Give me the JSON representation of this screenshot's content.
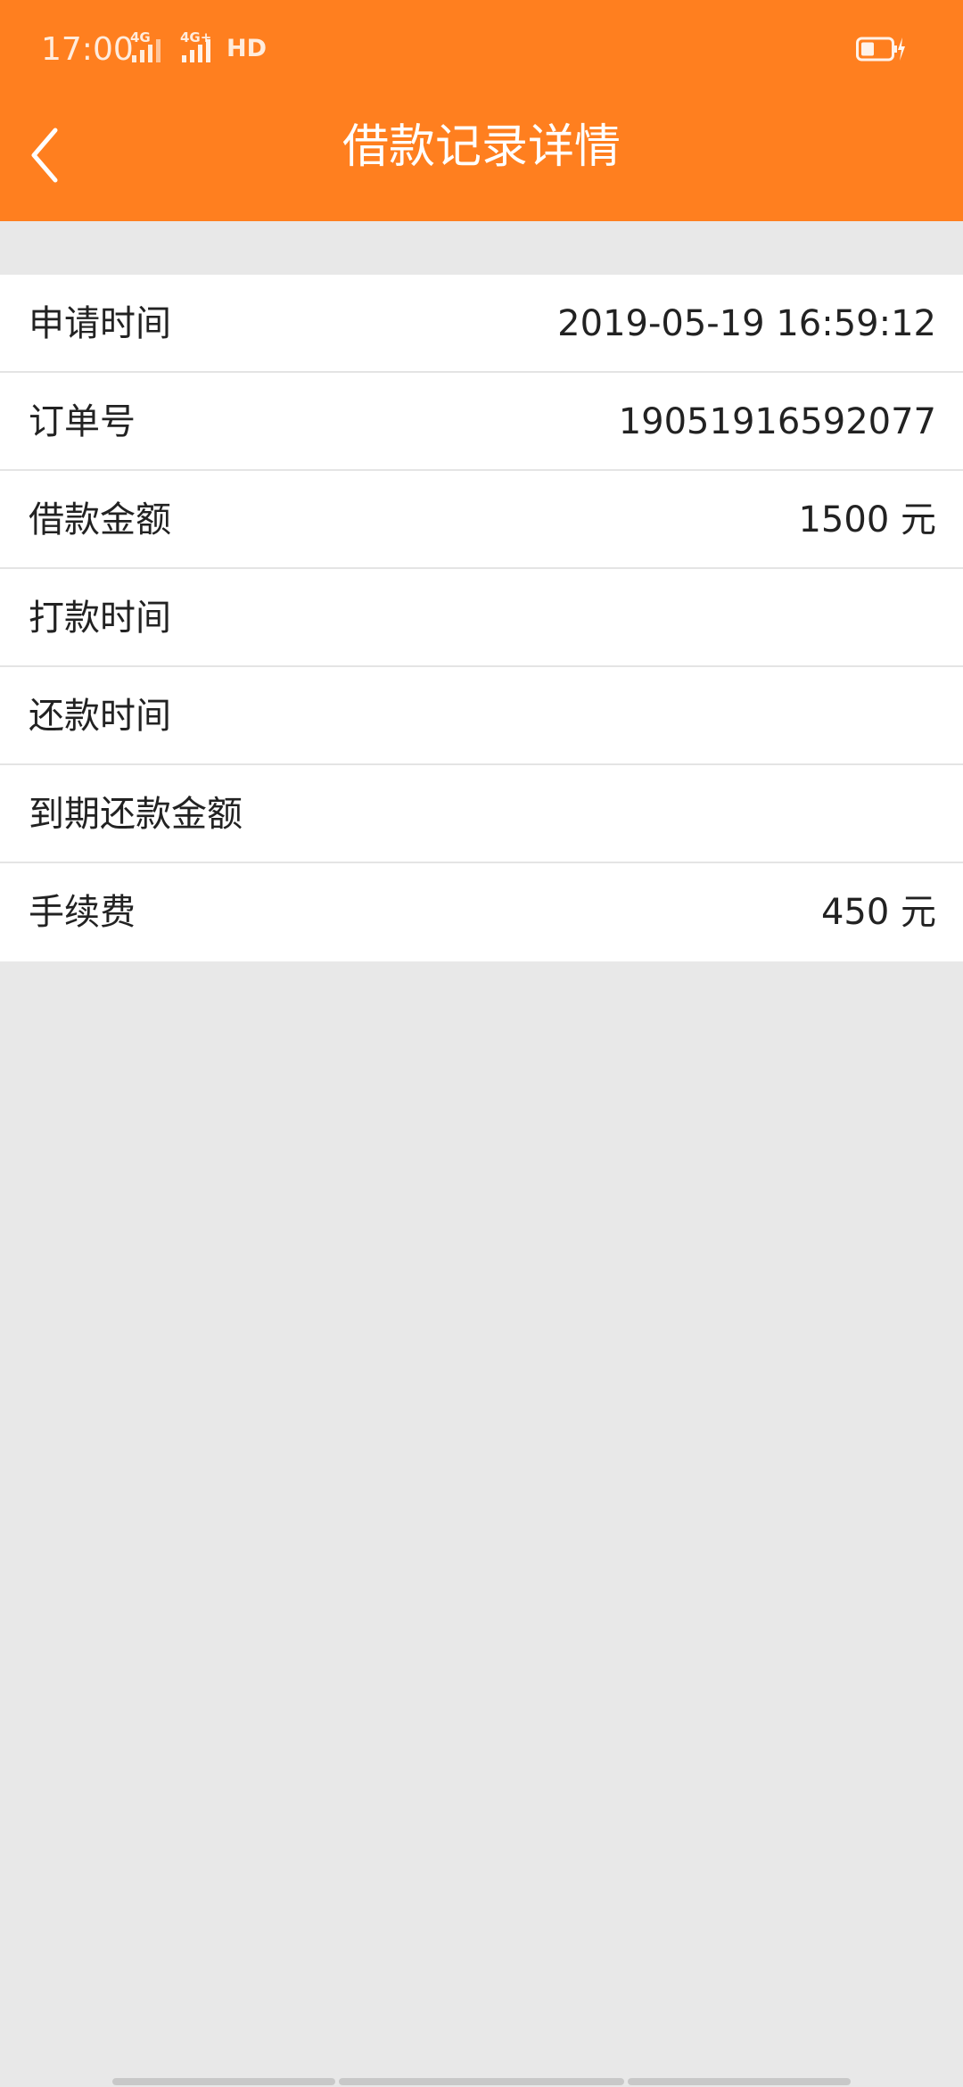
{
  "status_bar": {
    "time": "17:00",
    "sim1_network": "4G",
    "sim2_network": "4G+",
    "hd_label": "HD",
    "battery_icon": "battery-charging-icon"
  },
  "header": {
    "title": "借款记录详情",
    "back_icon": "chevron-left-icon",
    "background_color": "#ff7f1f"
  },
  "details": [
    {
      "label": "申请时间",
      "value": "2019-05-19 16:59:12"
    },
    {
      "label": "订单号",
      "value": "19051916592077"
    },
    {
      "label": "借款金额",
      "value": "1500 元"
    },
    {
      "label": "打款时间",
      "value": ""
    },
    {
      "label": "还款时间",
      "value": ""
    },
    {
      "label": "到期还款金额",
      "value": ""
    },
    {
      "label": "手续费",
      "value": "450 元"
    }
  ]
}
